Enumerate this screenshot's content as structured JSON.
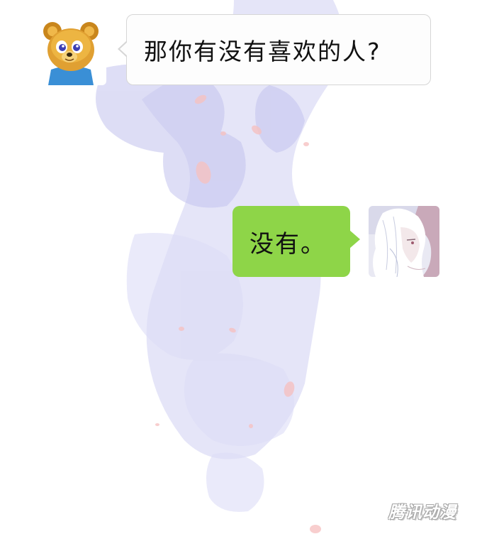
{
  "colors": {
    "page_background": "#ffffff",
    "ink_splash": "#c9c9ef",
    "petal": "#f7c4c4",
    "incoming_bubble": "#fdfdfd",
    "outgoing_bubble": "#8ed548"
  },
  "chat": {
    "messages": [
      {
        "sender": "other",
        "avatar_icon": "teddy-bear-avatar-icon",
        "text": "那你有没有喜欢的人?"
      },
      {
        "sender": "self",
        "avatar_icon": "white-haired-character-avatar-icon",
        "text": "没有。"
      }
    ]
  },
  "watermark": {
    "text": "腾讯动漫"
  }
}
